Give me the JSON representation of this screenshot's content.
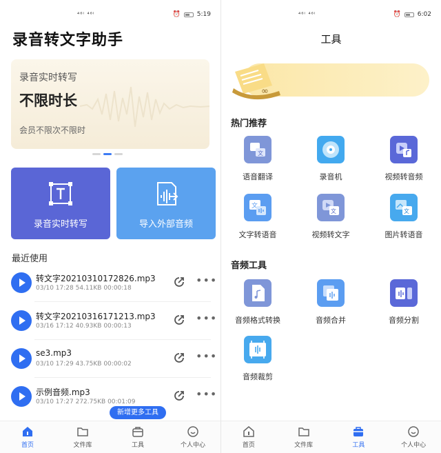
{
  "left": {
    "status": {
      "signal": "⁴⁶ᴵ ⁴⁶ᴵ",
      "time": "5:19"
    },
    "app_title": "录音转文字助手",
    "banner": {
      "line1": "录音实时转写",
      "line2": "不限时长",
      "line3": "会员不限次不限时"
    },
    "cards": {
      "transcribe": "录音实时转写",
      "import": "导入外部音频"
    },
    "recent_title": "最近使用",
    "recordings": [
      {
        "name": "转文字20210310172826.mp3",
        "date": "03/10 17:28",
        "size": "54.11KB",
        "duration": "00:00:18"
      },
      {
        "name": "转文字20210316171213.mp3",
        "date": "03/16 17:12",
        "size": "40.93KB",
        "duration": "00:00:13"
      },
      {
        "name": "se3.mp3",
        "date": "03/10 17:29",
        "size": "43.75KB",
        "duration": "00:00:02"
      },
      {
        "name": "示例音频.mp3",
        "date": "03/10 17:27",
        "size": "272.75KB",
        "duration": "00:01:09"
      }
    ],
    "tooltip": "新增更多工具",
    "tabs": [
      "首页",
      "文件库",
      "工具",
      "个人中心"
    ],
    "active_tab": 0
  },
  "right": {
    "status": {
      "signal": "⁴⁶ᴵ ⁴⁶ᴵ",
      "time": "6:02"
    },
    "header": "工具",
    "hot_title": "热门推荐",
    "hot_tools": [
      "语音翻译",
      "录音机",
      "视频转音频",
      "文字转语音",
      "视频转文字",
      "图片转语音"
    ],
    "audio_title": "音频工具",
    "audio_tools": [
      "音频格式转换",
      "音频合并",
      "音频分割",
      "音频裁剪"
    ],
    "tabs": [
      "首页",
      "文件库",
      "工具",
      "个人中心"
    ],
    "active_tab": 2
  },
  "colors": {
    "accent": "#2f6ef1",
    "card_purple": "#5a66d6",
    "card_blue": "#5ba2ef",
    "tile_blue": "#5b8ff0"
  }
}
